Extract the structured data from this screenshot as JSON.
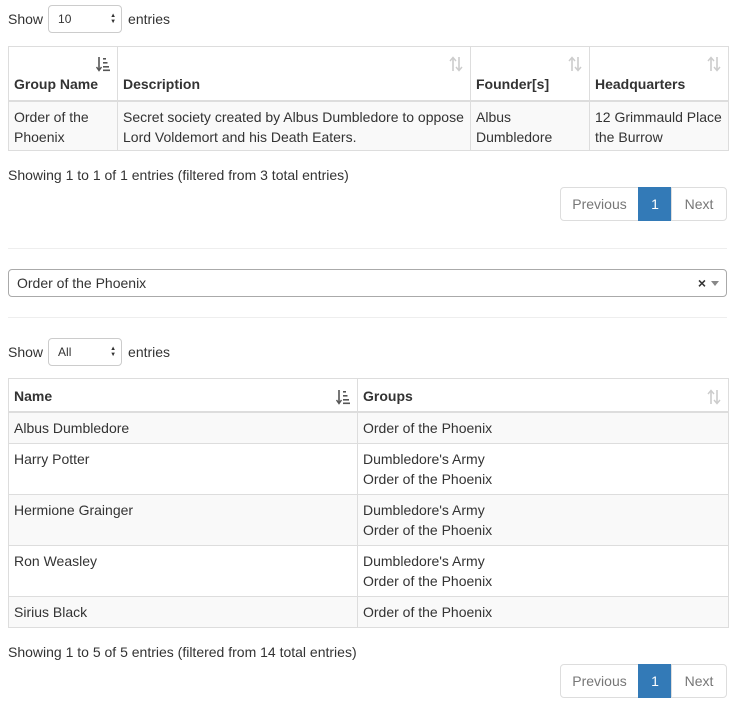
{
  "groups_table": {
    "length": {
      "show": "Show",
      "value": "10",
      "entries": "entries"
    },
    "columns": [
      "Group Name",
      "Description",
      "Founder[s]",
      "Headquarters"
    ],
    "rows": [
      {
        "name": "Order of the Phoenix",
        "description": "Secret society created by Albus Dumbledore to oppose Lord Voldemort and his Death Eaters.",
        "founders": "Albus Dumbledore",
        "headquarters": "12 Grimmauld Place the Burrow"
      }
    ],
    "info": "Showing 1 to 1 of 1 entries (filtered from 3 total entries)",
    "pagination": {
      "previous": "Previous",
      "current": "1",
      "next": "Next"
    }
  },
  "group_select": {
    "value": "Order of the Phoenix",
    "clear": "×"
  },
  "members_table": {
    "length": {
      "show": "Show",
      "value": "All",
      "entries": "entries"
    },
    "columns": [
      "Name",
      "Groups"
    ],
    "rows": [
      {
        "name": "Albus Dumbledore",
        "groups": [
          "Order of the Phoenix"
        ]
      },
      {
        "name": "Harry Potter",
        "groups": [
          "Dumbledore's Army",
          "Order of the Phoenix"
        ]
      },
      {
        "name": "Hermione Grainger",
        "groups": [
          "Dumbledore's Army",
          "Order of the Phoenix"
        ]
      },
      {
        "name": "Ron Weasley",
        "groups": [
          "Dumbledore's Army",
          "Order of the Phoenix"
        ]
      },
      {
        "name": "Sirius Black",
        "groups": [
          "Order of the Phoenix"
        ]
      }
    ],
    "info": "Showing 1 to 5 of 5 entries (filtered from 14 total entries)",
    "pagination": {
      "previous": "Previous",
      "current": "1",
      "next": "Next"
    }
  },
  "colors": {
    "accent": "#337ab7",
    "stripe": "#f9f9f9",
    "border": "#dddddd"
  }
}
